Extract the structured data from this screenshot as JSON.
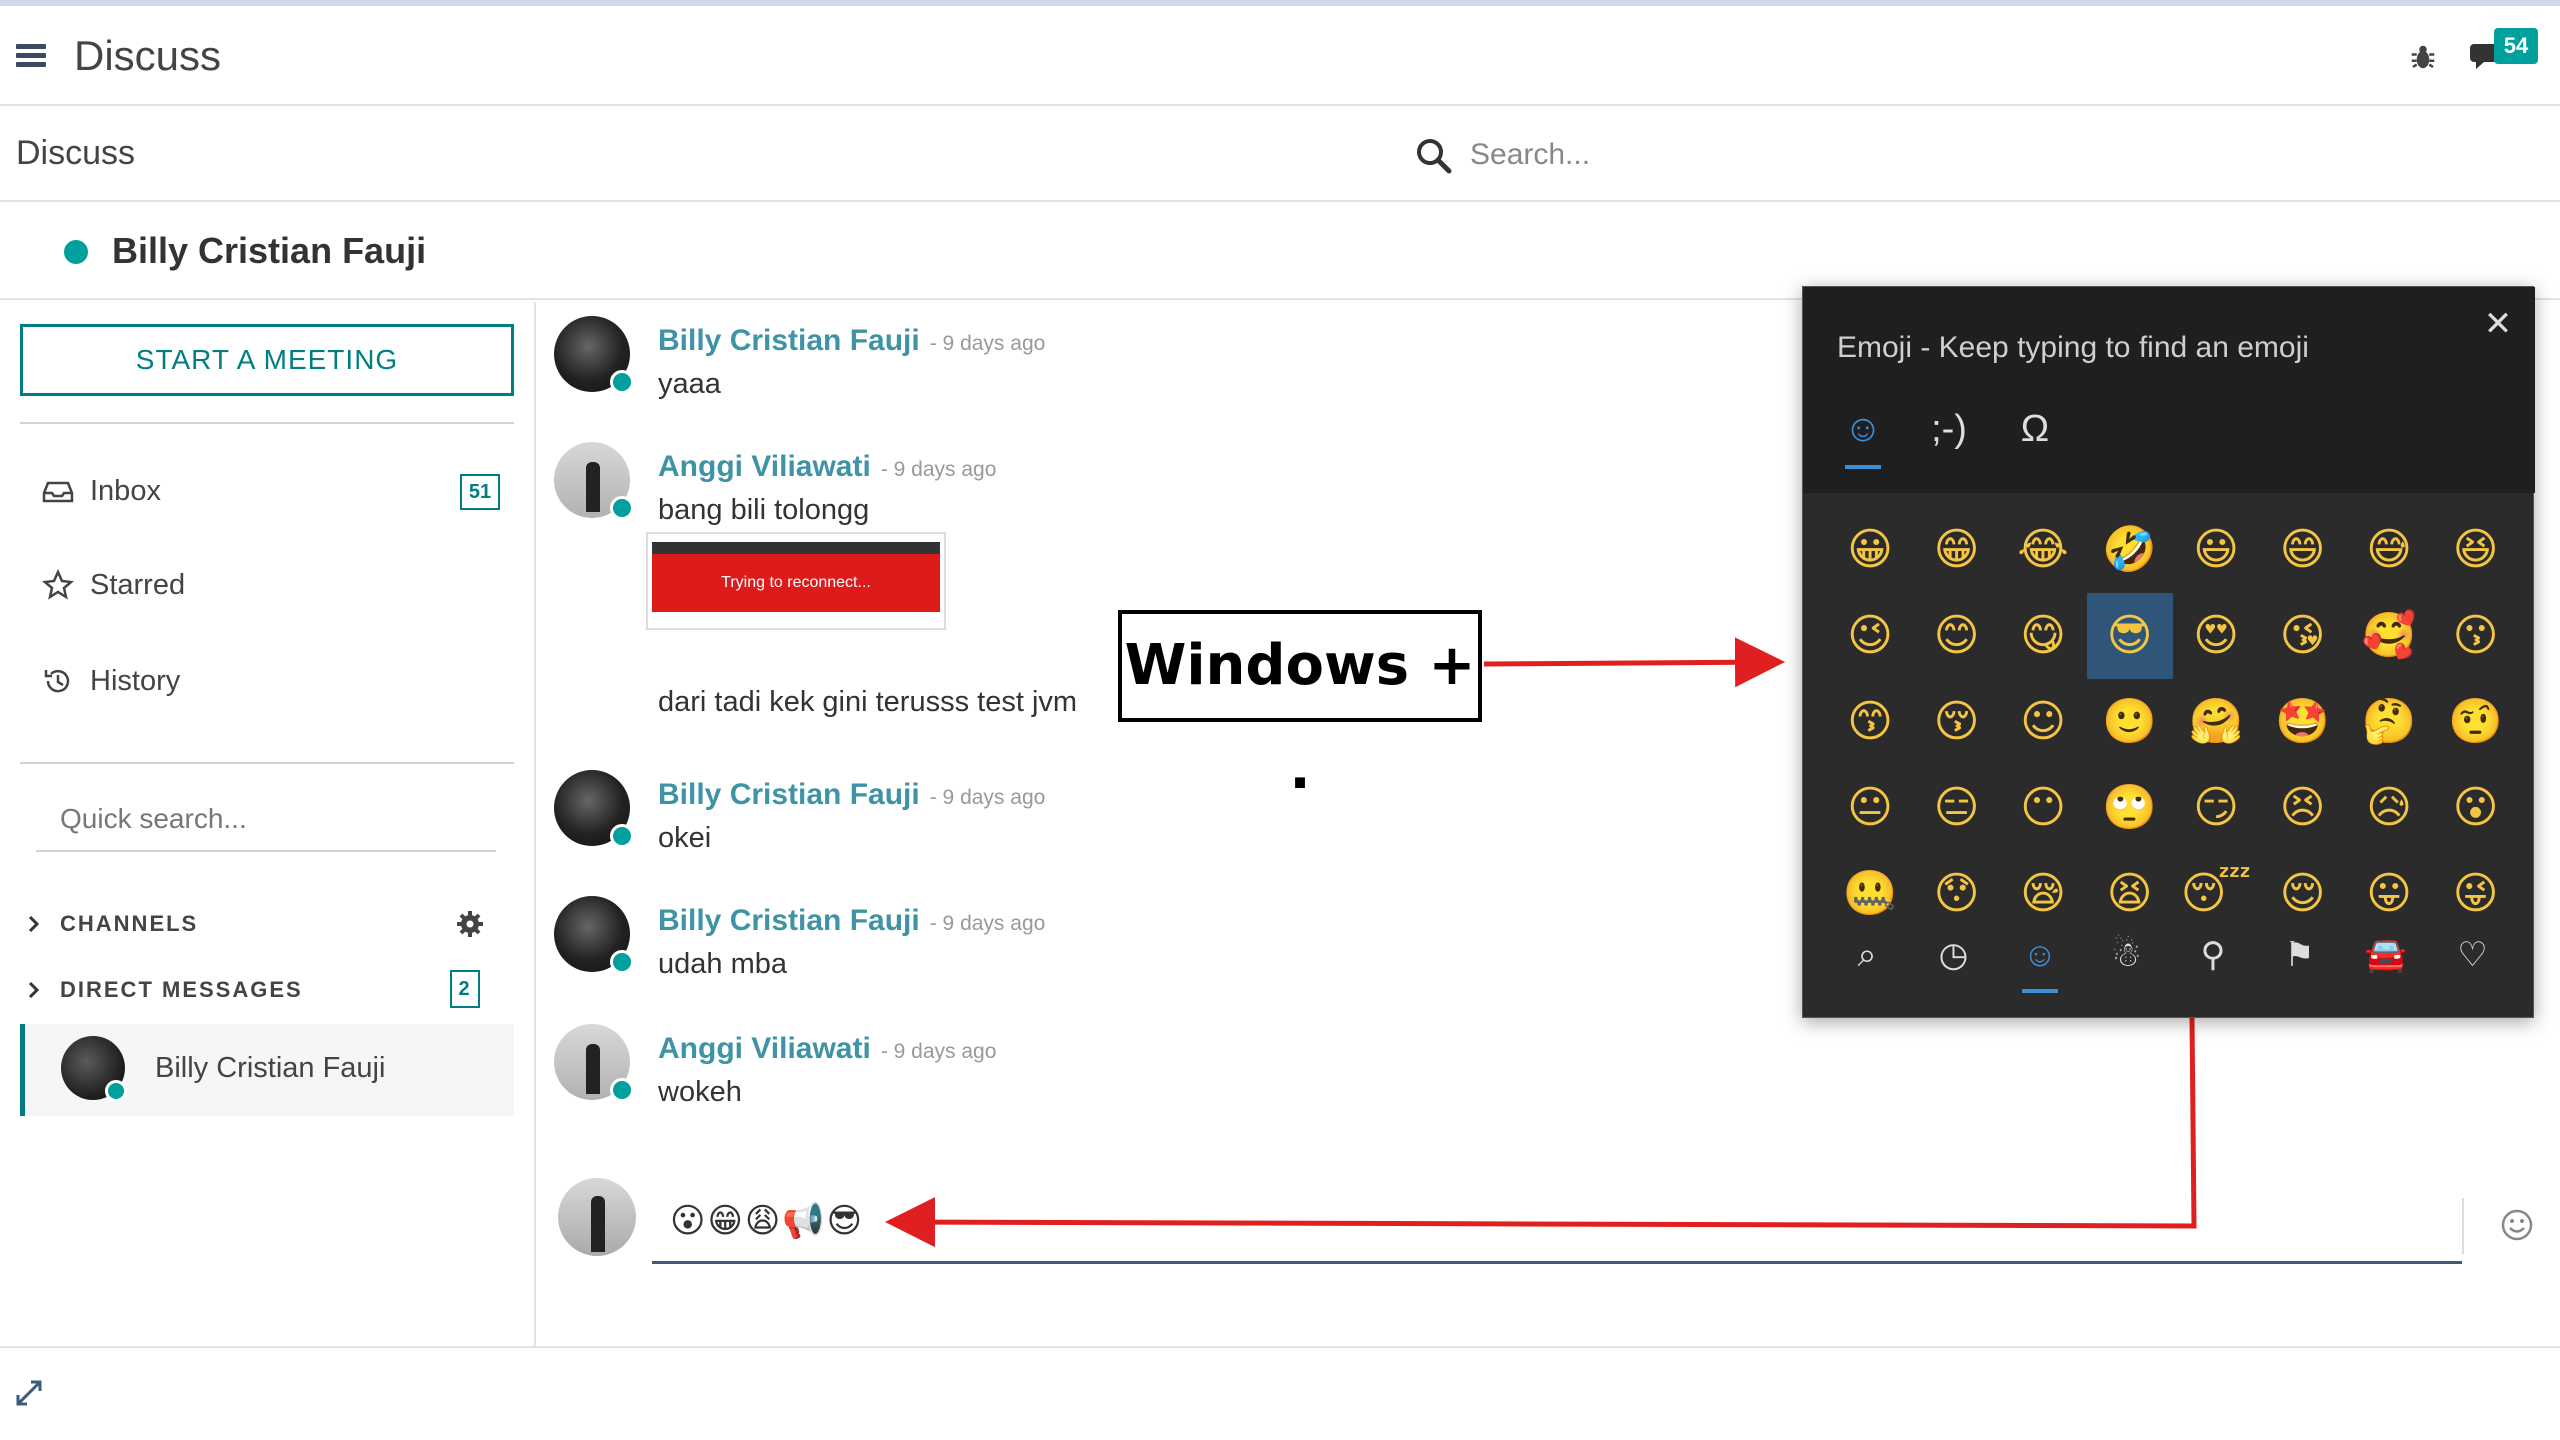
{
  "navbar": {
    "app_title": "Discuss",
    "chat_badge": "54"
  },
  "control_panel": {
    "title": "Discuss",
    "search_placeholder": "Search..."
  },
  "thread": {
    "name": "Billy Cristian Fauji"
  },
  "sidebar": {
    "meeting_button": "START A MEETING",
    "inbox_label": "Inbox",
    "inbox_count": "51",
    "starred_label": "Starred",
    "history_label": "History",
    "quick_search_placeholder": "Quick search...",
    "channels_label": "CHANNELS",
    "dm_label": "DIRECT MESSAGES",
    "dm_count": "2",
    "dm_item": "Billy Cristian Fauji"
  },
  "messages": [
    {
      "author": "Billy Cristian Fauji",
      "date": "- 9 days ago",
      "body": "yaaa"
    },
    {
      "author": "Anggi Viliawati",
      "date": "- 9 days ago",
      "body": "bang bili tolongg"
    },
    {
      "author": "Billy Cristian Fauji",
      "date": "- 9 days ago",
      "body": "okei"
    },
    {
      "author": "Billy Cristian Fauji",
      "date": "- 9 days ago",
      "body": "udah mba"
    },
    {
      "author": "Anggi Viliawati",
      "date": "- 9 days ago",
      "body": "wokeh"
    }
  ],
  "attachment": {
    "text": "Trying to reconnect..."
  },
  "extra_message": "dari tadi kek gini terusss test jvm",
  "composer": {
    "value": "😮😁😩📢😎"
  },
  "annotation": {
    "text": "Windows + ."
  },
  "emoji_panel": {
    "title": "Emoji - Keep typing to find an emoji",
    "close": "✕",
    "tabs": [
      "☺",
      ";-)",
      "Ω"
    ],
    "emojis": [
      "😀",
      "😁",
      "😂",
      "🤣",
      "😃",
      "😄",
      "😅",
      "😆",
      "😉",
      "😊",
      "😋",
      "😎",
      "😍",
      "😘",
      "🥰",
      "😗",
      "😙",
      "😚",
      "☺",
      "🙂",
      "🤗",
      "🤩",
      "🤔",
      "🤨",
      "😐",
      "😑",
      "😶",
      "🙄",
      "😏",
      "😣",
      "😥",
      "😮",
      "🤐",
      "😯",
      "😪",
      "😫",
      "😴",
      "😌",
      "😛",
      "😜"
    ],
    "selected_index": 11,
    "categories": [
      "⌕",
      "◷",
      "☺",
      "☃",
      "⚲",
      "⚑",
      "🚘",
      "♡"
    ]
  },
  "colors": {
    "accent": "#017e84",
    "link": "#3f93a5",
    "online": "#00a09d",
    "annotation_arrow": "#e02020"
  }
}
